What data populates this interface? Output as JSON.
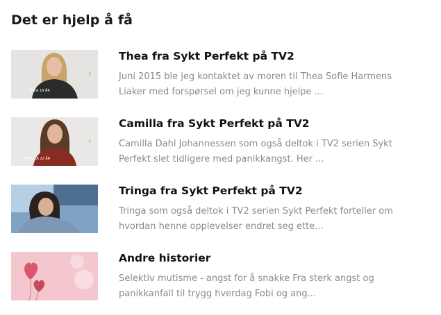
{
  "section": {
    "title": "Det er hjelp å få"
  },
  "items": [
    {
      "title": "Thea fra Sykt Perfekt på TV2",
      "description": "Juni 2015 ble jeg kontaktet av moren til Thea Sofie Harmens Liaker med forspørsel om jeg kunne hjelpe ...",
      "thumb_caption": "THEA 18 ÅR",
      "thumb_badge": "2"
    },
    {
      "title": "Camilla fra Sykt Perfekt på TV2",
      "description": "Camilla Dahl Johannessen som også deltok i TV2 serien Sykt Perfekt slet tidligere med panikkangst. Her ...",
      "thumb_caption": "CAMILLA 22 ÅR",
      "thumb_badge": "2"
    },
    {
      "title": "Tringa fra Sykt Perfekt på TV2",
      "description": "Tringa som også deltok i TV2 serien Sykt Perfekt forteller om hvordan henne opplevelser endret seg ette...",
      "thumb_caption": "",
      "thumb_badge": ""
    },
    {
      "title": "Andre historier",
      "description": "Selektiv mutisme - angst for å snakke Fra sterk angst og panikkanfall til trygg hverdag Fobi og ang...",
      "thumb_caption": "",
      "thumb_badge": ""
    }
  ]
}
